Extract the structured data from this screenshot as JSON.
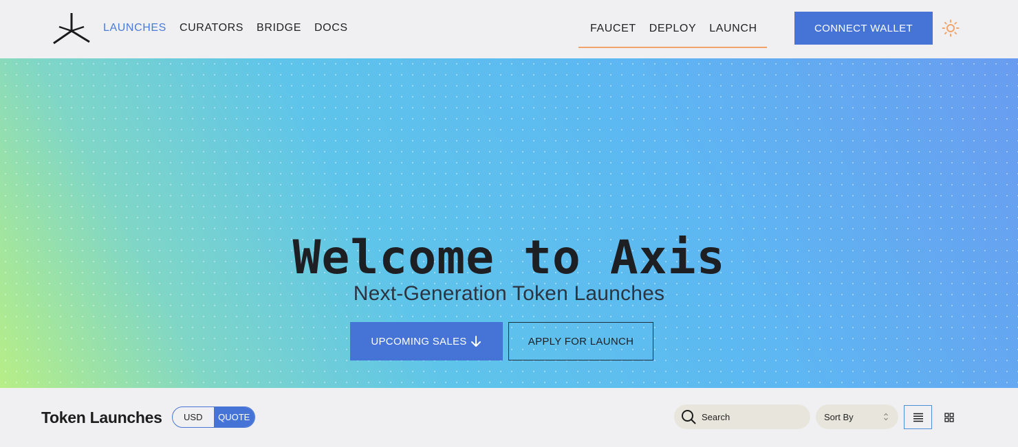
{
  "header": {
    "nav_left": [
      {
        "label": "LAUNCHES",
        "active": true
      },
      {
        "label": "CURATORS",
        "active": false
      },
      {
        "label": "BRIDGE",
        "active": false
      },
      {
        "label": "DOCS",
        "active": false
      }
    ],
    "nav_right": [
      {
        "label": "FAUCET"
      },
      {
        "label": "DEPLOY"
      },
      {
        "label": "LAUNCH"
      }
    ],
    "connect_label": "CONNECT WALLET",
    "icons": {
      "logo": "axis-logo-icon",
      "testnet": "flask-icon",
      "theme": "sun-icon"
    }
  },
  "hero": {
    "title": "Welcome to Axis",
    "subtitle": "Next-Generation Token Launches",
    "upcoming_label": "UPCOMING SALES",
    "apply_label": "APPLY FOR LAUNCH"
  },
  "toolbar": {
    "title": "Token Launches",
    "currency_options": [
      "USD",
      "QUOTE"
    ],
    "currency_selected": "QUOTE",
    "search_placeholder": "Search",
    "sort_label": "Sort By",
    "view_modes": [
      "list",
      "grid"
    ],
    "view_selected": "list"
  },
  "colors": {
    "accent": "#4674d6",
    "active_nav": "#4a7ad8",
    "underline": "#f2a36b",
    "sun": "#f2a36b"
  }
}
